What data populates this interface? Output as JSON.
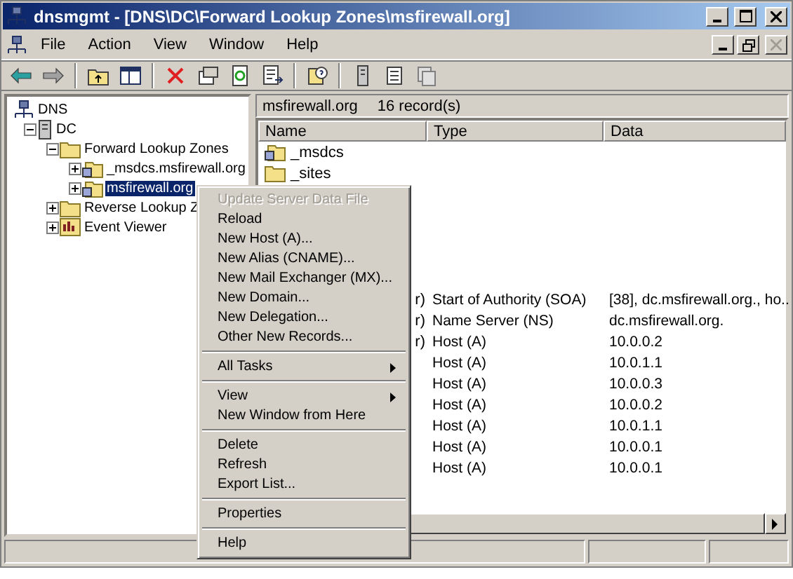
{
  "window": {
    "title": "dnsmgmt - [DNS\\DC\\Forward Lookup Zones\\msfirewall.org]"
  },
  "menu_bar": [
    {
      "label": "File"
    },
    {
      "label": "Action"
    },
    {
      "label": "View"
    },
    {
      "label": "Window"
    },
    {
      "label": "Help"
    }
  ],
  "tree": [
    {
      "label": "DNS",
      "kind": "dns",
      "selected": false,
      "children": [
        {
          "label": "DC",
          "kind": "server",
          "expanded": true,
          "selected": false,
          "children": [
            {
              "label": "Forward Lookup Zones",
              "kind": "folder",
              "expanded": true,
              "selected": false,
              "children": [
                {
                  "label": "_msdcs.msfirewall.org",
                  "kind": "zone",
                  "expanded": false,
                  "selected": false
                },
                {
                  "label": "msfirewall.org",
                  "kind": "zone",
                  "expanded": false,
                  "selected": true
                }
              ]
            },
            {
              "label": "Reverse Lookup Z",
              "kind": "folder",
              "expanded": false,
              "selected": false
            },
            {
              "label": "Event Viewer",
              "kind": "log",
              "expanded": false,
              "selected": false
            }
          ]
        }
      ]
    }
  ],
  "details": {
    "zone": "msfirewall.org",
    "count": "16 record(s)",
    "columns": [
      "Name",
      "Type",
      "Data"
    ],
    "folders": [
      {
        "name": "_msdcs",
        "kind": "delegated"
      },
      {
        "name": "_sites",
        "kind": "folder"
      }
    ],
    "records": [
      {
        "name": "r)",
        "type": "Start of Authority (SOA)",
        "data": "[38], dc.msfirewall.org., ho.."
      },
      {
        "name": "r)",
        "type": "Name Server (NS)",
        "data": "dc.msfirewall.org."
      },
      {
        "name": "r)",
        "type": "Host (A)",
        "data": "10.0.0.2"
      },
      {
        "type": "Host (A)",
        "data": "10.0.1.1"
      },
      {
        "type": "Host (A)",
        "data": "10.0.0.3"
      },
      {
        "type": "Host (A)",
        "data": "10.0.0.2"
      },
      {
        "type": "Host (A)",
        "data": "10.0.1.1"
      },
      {
        "type": "Host (A)",
        "data": "10.0.0.1"
      },
      {
        "type": "Host (A)",
        "data": "10.0.0.1"
      }
    ]
  },
  "context_menu": [
    {
      "kind": "item",
      "label": "Update Server Data File",
      "disabled": true
    },
    {
      "kind": "item",
      "label": "Reload",
      "disabled": false
    },
    {
      "kind": "item",
      "label": "New Host (A)...",
      "disabled": false
    },
    {
      "kind": "item",
      "label": "New Alias (CNAME)...",
      "disabled": false
    },
    {
      "kind": "item",
      "label": "New Mail Exchanger (MX)...",
      "disabled": false
    },
    {
      "kind": "item",
      "label": "New Domain...",
      "disabled": false
    },
    {
      "kind": "item",
      "label": "New Delegation...",
      "disabled": false
    },
    {
      "kind": "item",
      "label": "Other New Records...",
      "disabled": false
    },
    {
      "kind": "separator"
    },
    {
      "kind": "submenu",
      "label": "All Tasks",
      "disabled": false
    },
    {
      "kind": "separator"
    },
    {
      "kind": "submenu",
      "label": "View",
      "disabled": false
    },
    {
      "kind": "item",
      "label": "New Window from Here",
      "disabled": false
    },
    {
      "kind": "separator"
    },
    {
      "kind": "item",
      "label": "Delete",
      "disabled": false
    },
    {
      "kind": "item",
      "label": "Refresh",
      "disabled": false
    },
    {
      "kind": "item",
      "label": "Export List...",
      "disabled": false
    },
    {
      "kind": "separator"
    },
    {
      "kind": "item",
      "label": "Properties",
      "disabled": false
    },
    {
      "kind": "separator"
    },
    {
      "kind": "item",
      "label": "Help",
      "disabled": false
    }
  ]
}
